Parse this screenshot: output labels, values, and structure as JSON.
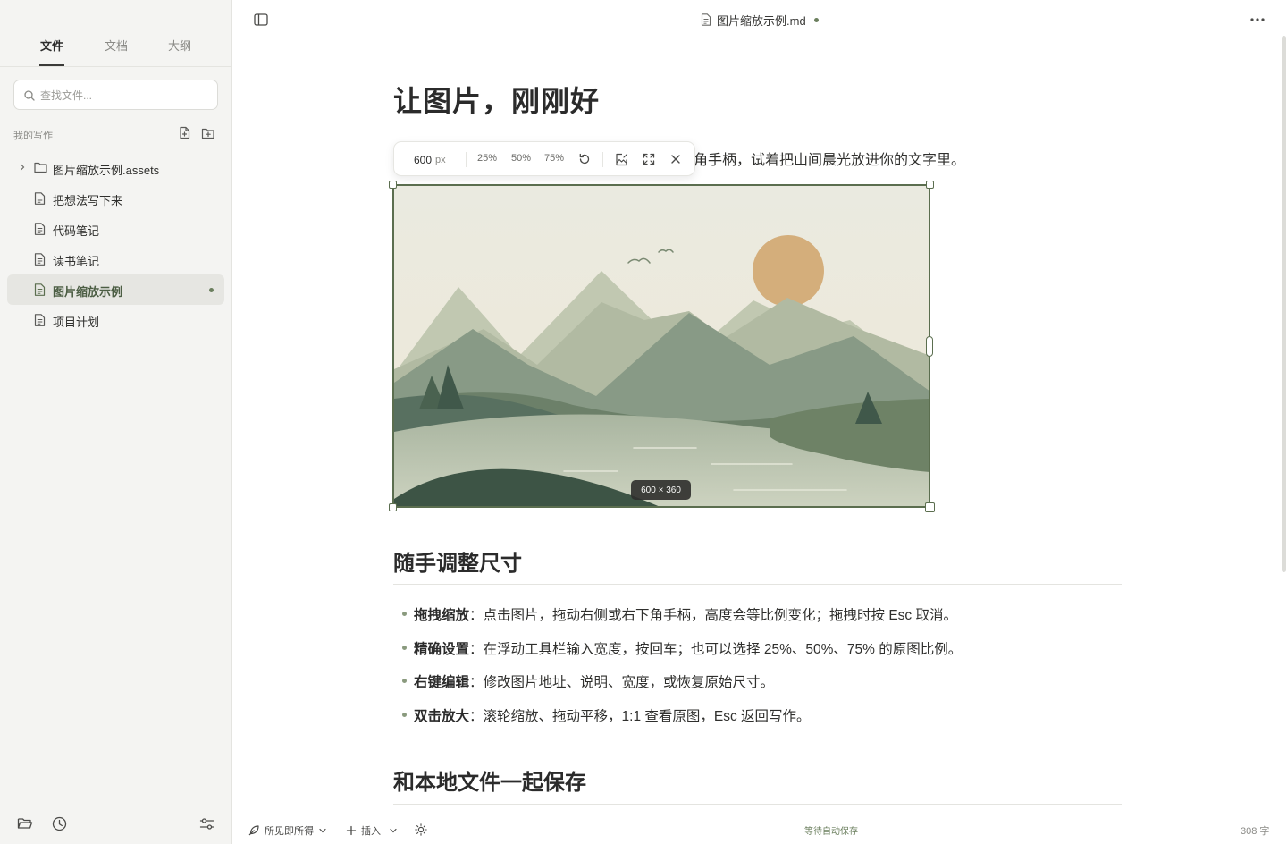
{
  "sidebar": {
    "tabs": [
      {
        "label": "文件",
        "active": true
      },
      {
        "label": "文档",
        "active": false
      },
      {
        "label": "大纲",
        "active": false
      }
    ],
    "search": {
      "placeholder": "查找文件..."
    },
    "section_title": "我的写作",
    "items": [
      {
        "label": "图片缩放示例.assets",
        "type": "folder"
      },
      {
        "label": "把想法写下来",
        "type": "file"
      },
      {
        "label": "代码笔记",
        "type": "file"
      },
      {
        "label": "读书笔记",
        "type": "file"
      },
      {
        "label": "图片缩放示例",
        "type": "file",
        "active": true,
        "modified": true
      },
      {
        "label": "项目计划",
        "type": "file"
      }
    ],
    "bottom_icons": [
      "folder-open-icon",
      "history-icon",
      "settings-sliders-icon"
    ]
  },
  "topbar": {
    "doc_title": "图片缩放示例.md",
    "modified": true
  },
  "editor": {
    "h1": "让图片，刚刚好",
    "intro_visible": "角手柄，试着把山间晨光放进你的文字里。",
    "image_toolbar": {
      "width_value": "600",
      "width_unit": "px",
      "presets": [
        "25%",
        "50%",
        "75%"
      ]
    },
    "image_size_badge": "600 × 360",
    "h2_resize": "随手调整尺寸",
    "bullets": [
      {
        "term": "拖拽缩放",
        "text": "：点击图片，拖动右侧或右下角手柄，高度会等比例变化；拖拽时按 Esc 取消。"
      },
      {
        "term": "精确设置",
        "text": "：在浮动工具栏输入宽度，按回车；也可以选择 25%、50%、75% 的原图比例。"
      },
      {
        "term": "右键编辑",
        "text": "：修改图片地址、说明、宽度，或恢复原始尺寸。"
      },
      {
        "term": "双击放大",
        "text": "：滚轮缩放、拖动平移，1:1 查看原图，Esc 返回写作。"
      }
    ],
    "h2_save": "和本地文件一起保存"
  },
  "statusbar": {
    "mode": "所见即所得",
    "insert": "插入",
    "save_status": "等待自动保存",
    "word_count": "308 字"
  },
  "colors": {
    "accent": "#5b6e4f",
    "sidebar_bg": "#f4f4f2",
    "save_status": "#6b7f5e"
  }
}
